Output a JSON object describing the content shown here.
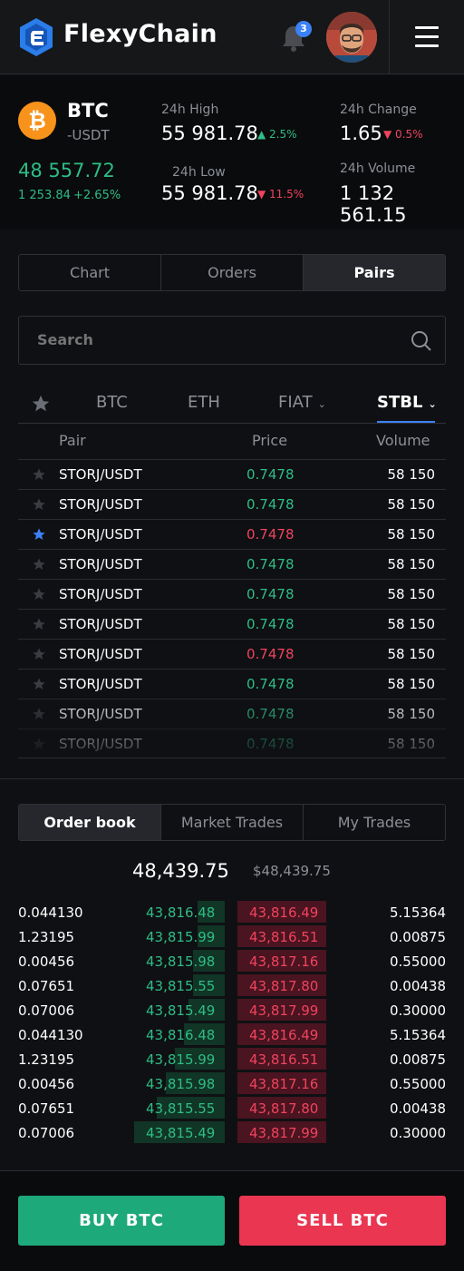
{
  "app": {
    "name": "FlexyChain",
    "notifications": "3"
  },
  "ticker": {
    "symbol": "BTC",
    "quote": "-USDT",
    "coin_glyph": "₿",
    "last_price": "48 557.72",
    "change_abs": "1 253.84",
    "change_pct": "+2.65%",
    "high_label": "24h High",
    "high_value": "55 981.78",
    "high_change": "▲ 2.5%",
    "low_label": "24h Low",
    "low_value": "55 981.78",
    "low_change": "▼ 11.5%",
    "change_label": "24h Change",
    "change_value": "1.65",
    "change_change": "▼ 0.5%",
    "volume_label": "24h Volume",
    "volume_value": "1 132 561.15"
  },
  "view_tabs": [
    "Chart",
    "Orders",
    "Pairs"
  ],
  "search": {
    "placeholder": "Search"
  },
  "pair_filters": {
    "btc": "BTC",
    "eth": "ETH",
    "fiat": "FIAT",
    "stbl": "STBL"
  },
  "pair_columns": {
    "pair": "Pair",
    "price": "Price",
    "volume": "Volume"
  },
  "pairs": [
    {
      "pair": "STORJ/USDT",
      "price": "0.7478",
      "volume": "58 150",
      "fav": false,
      "dir": "up"
    },
    {
      "pair": "STORJ/USDT",
      "price": "0.7478",
      "volume": "58 150",
      "fav": false,
      "dir": "up"
    },
    {
      "pair": "STORJ/USDT",
      "price": "0.7478",
      "volume": "58 150",
      "fav": true,
      "dir": "down"
    },
    {
      "pair": "STORJ/USDT",
      "price": "0.7478",
      "volume": "58 150",
      "fav": false,
      "dir": "up"
    },
    {
      "pair": "STORJ/USDT",
      "price": "0.7478",
      "volume": "58 150",
      "fav": false,
      "dir": "up"
    },
    {
      "pair": "STORJ/USDT",
      "price": "0.7478",
      "volume": "58 150",
      "fav": false,
      "dir": "up"
    },
    {
      "pair": "STORJ/USDT",
      "price": "0.7478",
      "volume": "58 150",
      "fav": false,
      "dir": "down"
    },
    {
      "pair": "STORJ/USDT",
      "price": "0.7478",
      "volume": "58 150",
      "fav": false,
      "dir": "up"
    },
    {
      "pair": "STORJ/USDT",
      "price": "0.7478",
      "volume": "58 150",
      "fav": false,
      "dir": "up"
    },
    {
      "pair": "STORJ/USDT",
      "price": "0.7478",
      "volume": "58 150",
      "fav": false,
      "dir": "up"
    }
  ],
  "trade_tabs": [
    "Order book",
    "Market Trades",
    "My Trades"
  ],
  "orderbook": {
    "last_price": "48,439.75",
    "last_price_usd": "$48,439.75",
    "rows": [
      {
        "bid_qty": "0.044130",
        "bid": "43,816.48",
        "ask": "43,816.49",
        "ask_qty": "5.15364",
        "bid_depth": 0.3,
        "ask_depth": 0.55
      },
      {
        "bid_qty": "1.23195",
        "bid": "43,815.99",
        "ask": "43,816.51",
        "ask_qty": "0.00875",
        "bid_depth": 0.3,
        "ask_depth": 0.55
      },
      {
        "bid_qty": "0.00456",
        "bid": "43,815.98",
        "ask": "43,817.16",
        "ask_qty": "0.55000",
        "bid_depth": 0.35,
        "ask_depth": 0.55
      },
      {
        "bid_qty": "0.07651",
        "bid": "43,815.55",
        "ask": "43,817.80",
        "ask_qty": "0.00438",
        "bid_depth": 0.35,
        "ask_depth": 0.55
      },
      {
        "bid_qty": "0.07006",
        "bid": "43,815.49",
        "ask": "43,817.99",
        "ask_qty": "0.30000",
        "bid_depth": 0.4,
        "ask_depth": 0.55
      },
      {
        "bid_qty": "0.044130",
        "bid": "43,816.48",
        "ask": "43,816.49",
        "ask_qty": "5.15364",
        "bid_depth": 0.45,
        "ask_depth": 0.55
      },
      {
        "bid_qty": "1.23195",
        "bid": "43,815.99",
        "ask": "43,816.51",
        "ask_qty": "0.00875",
        "bid_depth": 0.55,
        "ask_depth": 0.55
      },
      {
        "bid_qty": "0.00456",
        "bid": "43,815.98",
        "ask": "43,817.16",
        "ask_qty": "0.55000",
        "bid_depth": 0.65,
        "ask_depth": 0.55
      },
      {
        "bid_qty": "0.07651",
        "bid": "43,815.55",
        "ask": "43,817.80",
        "ask_qty": "0.00438",
        "bid_depth": 0.75,
        "ask_depth": 0.55
      },
      {
        "bid_qty": "0.07006",
        "bid": "43,815.49",
        "ask": "43,817.99",
        "ask_qty": "0.30000",
        "bid_depth": 1.0,
        "ask_depth": 0.55
      }
    ]
  },
  "actions": {
    "buy": "BUY BTC",
    "sell": "SELL BTC"
  },
  "colors": {
    "up": "#2ebd85",
    "down": "#f0435e",
    "accent": "#3b82f6",
    "buy": "#1ea97b",
    "sell": "#ea3651"
  }
}
